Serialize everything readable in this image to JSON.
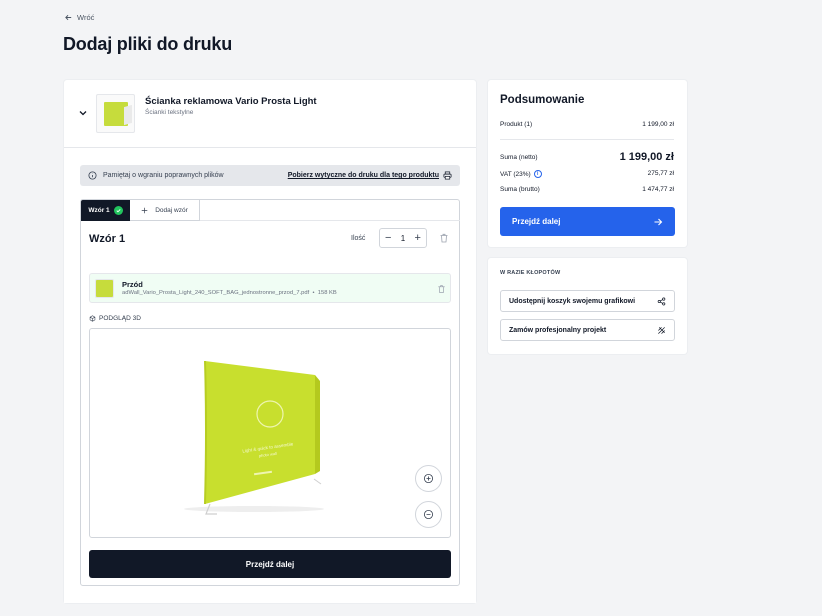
{
  "nav": {
    "back_label": "Wróć"
  },
  "page": {
    "title": "Dodaj pliki do druku"
  },
  "product": {
    "name": "Ścianka reklamowa Vario Prosta Light",
    "category": "Ścianki tekstylne"
  },
  "notice": {
    "text": "Pamiętaj o wgraniu poprawnych plików",
    "download_link": "Pobierz wytyczne do druku dla tego produktu"
  },
  "design": {
    "tabs": [
      {
        "label": "Wzór 1",
        "active": true
      },
      {
        "label": "Dodaj wzór",
        "active": false
      }
    ],
    "title": "Wzór 1",
    "quantity_label": "Ilość",
    "quantity": "1",
    "file": {
      "side": "Przód",
      "name": "adWall_Vario_Prosta_Light_240_SOFT_BAG_jednostronne_przod_7.pdf",
      "size": "158 KB"
    },
    "preview_label": "PODGLĄD 3D",
    "cta": "Przejdź dalej"
  },
  "summary": {
    "title": "Podsumowanie",
    "product_label": "Produkt (1)",
    "product_value": "1 199,00 zł",
    "net_label": "Suma (netto)",
    "net_value": "1 199,00 zł",
    "vat_label": "VAT (23%)",
    "vat_value": "275,77 zł",
    "gross_label": "Suma (brutto)",
    "gross_value": "1 474,77 zł",
    "cta": "Przejdź dalej"
  },
  "help": {
    "title": "W RAZIE KŁOPOTÓW",
    "share_button": "Udostępnij koszyk swojemu grafikowi",
    "order_button": "Zamów profesjonalny projekt"
  },
  "colors": {
    "primary_blue": "#2563eb",
    "dark": "#111827",
    "product_green": "#c6dc3c",
    "success": "#22c55e"
  }
}
